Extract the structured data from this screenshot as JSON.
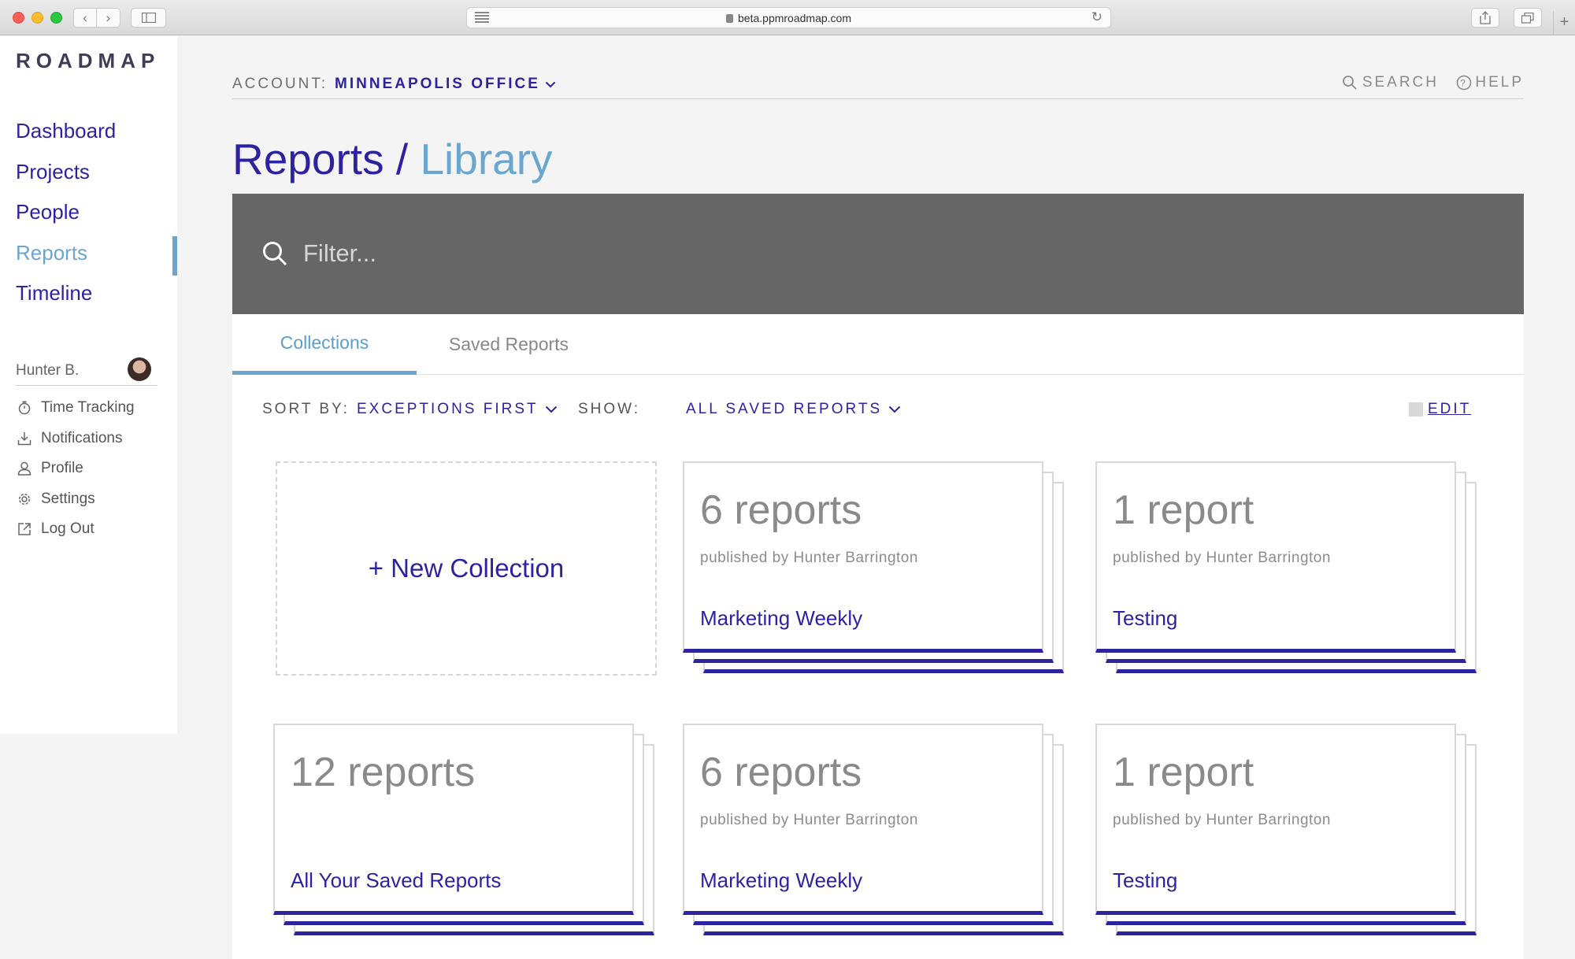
{
  "browser": {
    "url": "beta.ppmroadmap.com"
  },
  "sidebar": {
    "logo": "ROADMAP",
    "nav": [
      {
        "label": "Dashboard"
      },
      {
        "label": "Projects"
      },
      {
        "label": "People"
      },
      {
        "label": "Reports",
        "active": true
      },
      {
        "label": "Timeline"
      }
    ],
    "user": {
      "name": "Hunter B."
    },
    "menu": [
      {
        "label": "Time Tracking",
        "icon": "stopwatch-icon"
      },
      {
        "label": "Notifications",
        "icon": "download-icon"
      },
      {
        "label": "Profile",
        "icon": "person-icon"
      },
      {
        "label": "Settings",
        "icon": "gear-icon"
      },
      {
        "label": "Log Out",
        "icon": "external-link-icon"
      }
    ]
  },
  "header": {
    "account_label": "ACCOUNT:",
    "account_value": "MINNEAPOLIS OFFICE",
    "search_label": "SEARCH",
    "help_label": "HELP"
  },
  "page": {
    "title": "Reports /",
    "subtitle": "Library"
  },
  "filter": {
    "placeholder": "Filter..."
  },
  "tabs": [
    {
      "label": "Collections",
      "active": true
    },
    {
      "label": "Saved Reports",
      "active": false
    }
  ],
  "toolbar": {
    "sort_label": "SORT BY:",
    "sort_value": "EXCEPTIONS FIRST",
    "show_label": "SHOW:",
    "show_value": "ALL SAVED REPORTS",
    "edit_label": "EDIT"
  },
  "new_collection_label": "+ New Collection",
  "collections": [
    {
      "count": "6 reports",
      "published_by": "published by Hunter Barrington",
      "name": "Marketing Weekly"
    },
    {
      "count": "1 report",
      "published_by": "published by Hunter Barrington",
      "name": "Testing"
    },
    {
      "count": "12 reports",
      "published_by": "",
      "name": "All Your Saved Reports"
    },
    {
      "count": "6 reports",
      "published_by": "published by Hunter Barrington",
      "name": "Marketing Weekly"
    },
    {
      "count": "1 report",
      "published_by": "published by Hunter Barrington",
      "name": "Testing"
    }
  ],
  "colors": {
    "brand": "#2d23a0",
    "accent": "#6aa6cf",
    "filter_bar": "#666666"
  }
}
